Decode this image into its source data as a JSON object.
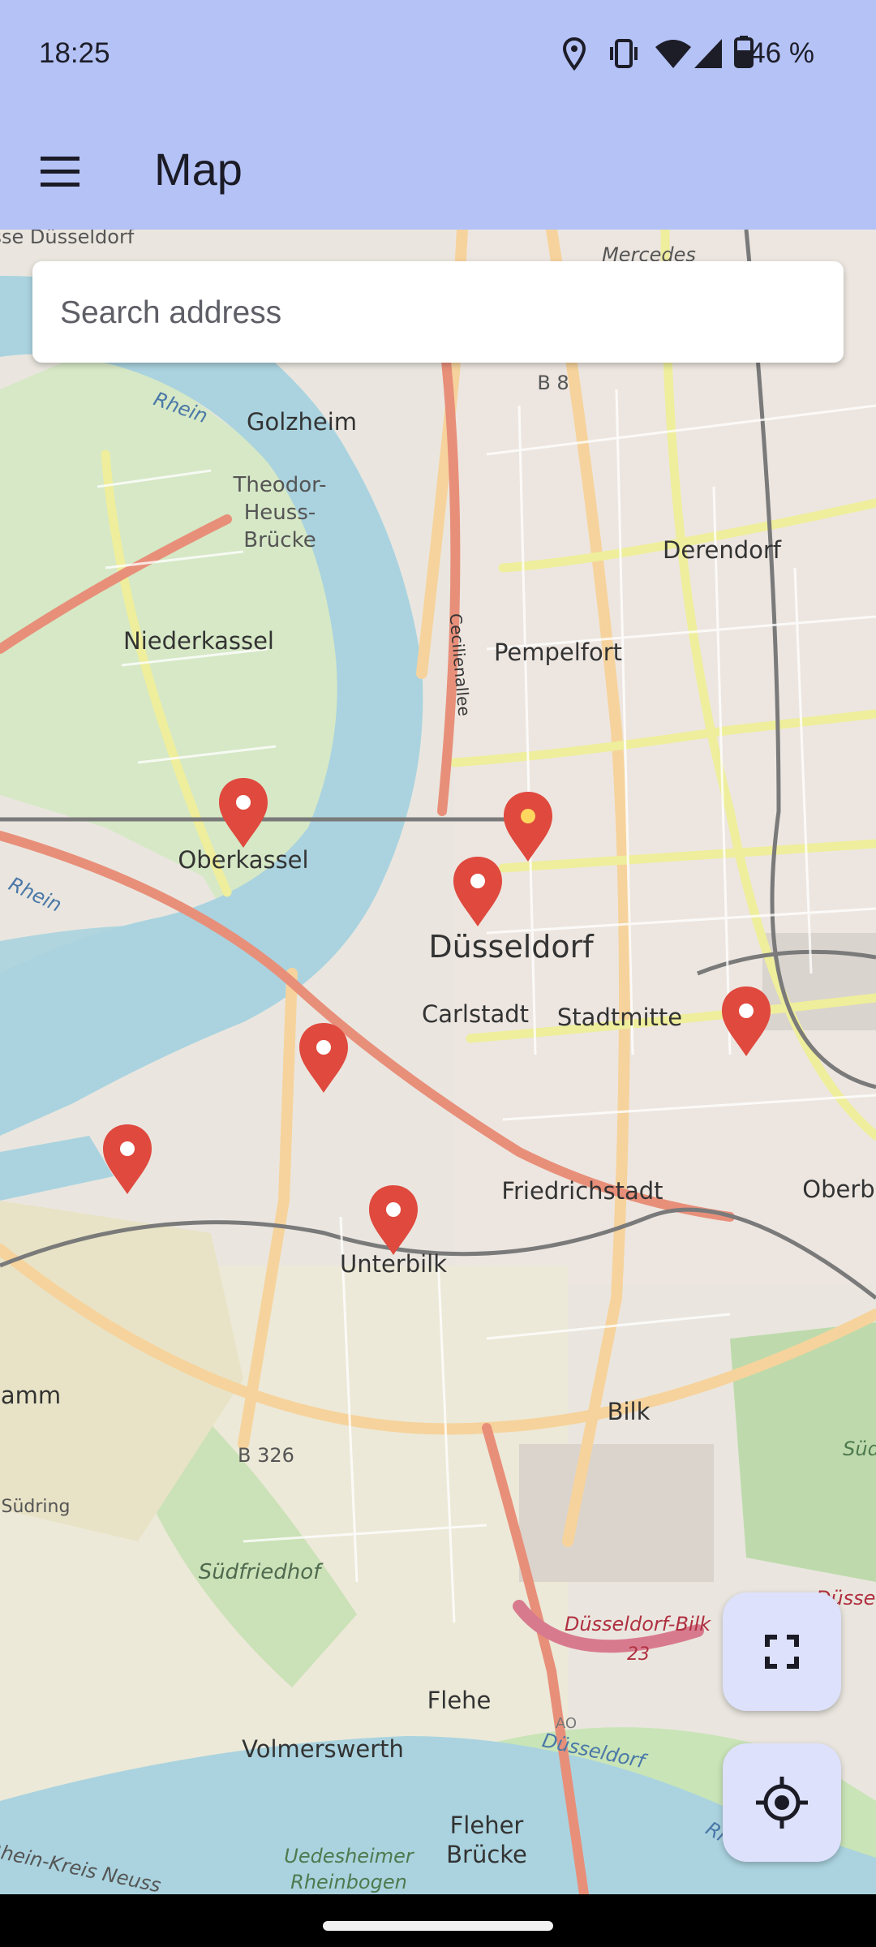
{
  "status_bar": {
    "time": "18:25",
    "battery_text": "46 %",
    "icons": [
      "location-icon",
      "vibrate-icon",
      "wifi-icon",
      "signal-icon",
      "battery-icon"
    ]
  },
  "toolbar": {
    "menu_icon": "hamburger-menu-icon",
    "title": "Map"
  },
  "search": {
    "placeholder": "Search address",
    "value": ""
  },
  "map": {
    "labels": {
      "top_left": "esse Düsseldorf",
      "top_right": "Mercedes",
      "b8": "B 8",
      "golzheim": "Golzheim",
      "rhein_1": "Rhein",
      "theodor": "Theodor-",
      "heuss": "Heuss-",
      "bruecke": "Brücke",
      "derendorf": "Derendorf",
      "niederkassel": "Niederkassel",
      "cecilienallee": "Cecilienallee",
      "pempelfort": "Pempelfort",
      "oberkassel": "Oberkassel",
      "rhein_2": "Rhein",
      "duesseldorf": "Düsseldorf",
      "carlstadt": "Carlstadt",
      "stadtmitte": "Stadtmitte",
      "friedrichstadt": "Friedrichstadt",
      "oberb": "Oberb",
      "unterbilk": "Unterbilk",
      "hamm": "lamm",
      "bilk": "Bilk",
      "b326": "B 326",
      "sued": "Süd",
      "suedring": "Südring",
      "suedfriedhof": "Südfriedhof",
      "dussel": "Düssel",
      "dd_bilk": "Düsseldorf-Bilk",
      "junction_23": "23",
      "flehe": "Flehe",
      "volmerswerth": "Volmerswerth",
      "duesseldorf_river": "Düsseldorf",
      "fleher": "Fleher",
      "fleher_bruecke": "Brücke",
      "rhein_kreis": "Rhein-Kreis Neuss",
      "uedesheimer": "Uedesheimer",
      "rheinbogen": "Rheinbogen",
      "rhein_3": "Rhein",
      "ao": "AO"
    },
    "marker_count": 7,
    "marker_color": "#e0493e"
  },
  "fabs": {
    "fullscreen_icon": "fullscreen-icon",
    "location_icon": "my-location-icon"
  },
  "colors": {
    "app_bar": "#b4c2f6",
    "fab_bg": "#dde1fb",
    "river": "#aad3df",
    "marker": "#e0493e"
  }
}
